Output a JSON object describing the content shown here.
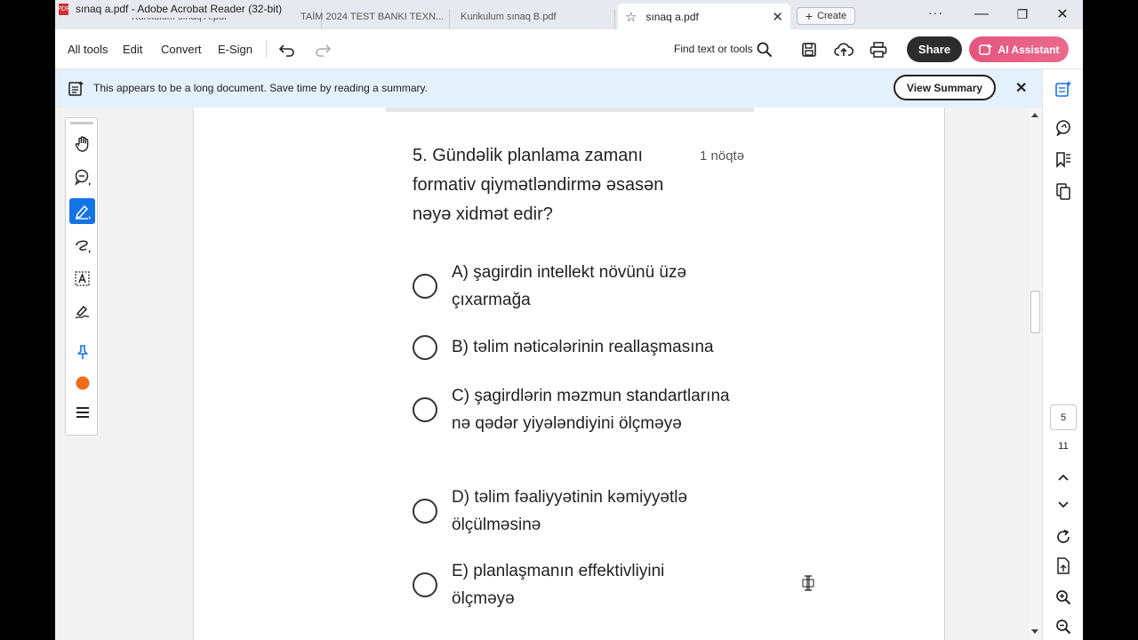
{
  "window": {
    "title": "sınaq a.pdf - Adobe Acrobat Reader (32-bit)",
    "pdf_icon_label": "PDF",
    "minimize_glyph": "—",
    "maximize_glyph": "❐",
    "close_glyph": "✕"
  },
  "tabs": {
    "background": [
      "Kurikulum sınaq A.pdf",
      "TAİM 2024 TEST BANKI TEXN...",
      "Kurikulum sınaq B.pdf"
    ],
    "active": {
      "label": "sınaq a.pdf",
      "star_glyph": "☆",
      "close_glyph": "✕"
    },
    "create_label": "Create",
    "create_glyph": "+",
    "more_glyph": "···"
  },
  "toolbar": {
    "all_tools": "All tools",
    "edit": "Edit",
    "convert": "Convert",
    "esign": "E-Sign",
    "find_label": "Find text or tools",
    "share_label": "Share",
    "ai_label": "AI Assistant"
  },
  "banner": {
    "message": "This appears to be a long document. Save time by reading a summary.",
    "button_label": "View Summary",
    "close_glyph": "✕"
  },
  "document": {
    "question": "5. Gündəlik planlama zamanı formativ qiymətləndirmə əsasən nəyə xidmət edir?",
    "points": "1 nöqtə",
    "options": [
      "A) şagirdin intellekt növünü üzə çıxarmağa",
      "B) təlim nəticələrinin reallaşmasına",
      "C) şagirdlərin məzmun standartlarına nə qədər yiyələndiyini ölçməyə",
      "D) təlim fəaliyyətinin kəmiyyətlə ölçülməsinə",
      "E) planlaşmanın effektivliyini ölçməyə"
    ]
  },
  "navigation": {
    "current_page": "5",
    "total_pages": "11"
  },
  "colors": {
    "accent_blue": "#1473e6",
    "banner_bg": "#e4f0fc",
    "share_bg": "#2c2c2c",
    "ai_gradient_start": "#e5567e",
    "ai_gradient_end": "#ea6a8c",
    "stamp_orange": "#f26a1b"
  },
  "icons": {
    "left_rail": [
      "hand-icon",
      "comment-icon",
      "highlight-pen-icon",
      "freehand-draw-icon",
      "text-select-icon",
      "sign-icon",
      "pin-icon",
      "color-dot-icon",
      "menu-icon"
    ],
    "right_panel": [
      "summary-icon",
      "comments-panel-icon",
      "bookmark-icon",
      "pages-icon",
      "chevron-up-icon",
      "chevron-down-icon",
      "rotate-icon",
      "page-export-icon",
      "zoom-in-icon",
      "zoom-out-icon"
    ]
  }
}
